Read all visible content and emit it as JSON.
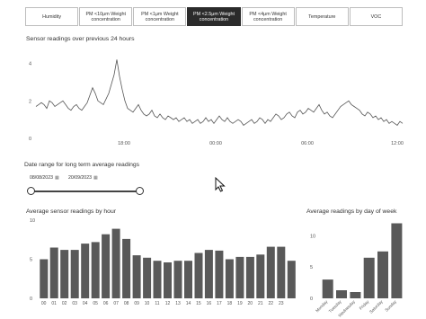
{
  "tabs": [
    {
      "label": "Humidity",
      "active": false
    },
    {
      "label": "PM <10μm Weight\nconcentration",
      "active": false
    },
    {
      "label": "PM <1μm Weight\nconcentration",
      "active": false
    },
    {
      "label": "PM <2.5μm Weight\nconcentration",
      "active": true
    },
    {
      "label": "PM <4μm Weight\nconcentration",
      "active": false
    },
    {
      "label": "Temperature",
      "active": false
    },
    {
      "label": "VOC",
      "active": false
    }
  ],
  "colors": {
    "active_tab": "#2b2b2b",
    "bars": "#595959",
    "line": "#555555"
  },
  "line_section": {
    "title": "Sensor readings over previous 24 hours"
  },
  "date_section": {
    "title": "Date range for long term average readings",
    "start_date": "08/08/2023",
    "end_date": "20/09/2023",
    "calendar_icon": "calendar-icon",
    "range_fraction": [
      0,
      1
    ]
  },
  "hour_section": {
    "title": "Average sensor readings by hour"
  },
  "week_section": {
    "title": "Average readings by day of week"
  },
  "cursor_icon": "arrow-cursor-icon",
  "chart_data": [
    {
      "type": "line",
      "title": "Sensor readings over previous 24 hours",
      "x_ticks": [
        "18:00",
        "00:00",
        "06:00",
        "12:00"
      ],
      "y_ticks": [
        0,
        2,
        4
      ],
      "ylim": [
        0,
        4.6
      ],
      "series": [
        {
          "values": [
            1.7,
            1.8,
            1.9,
            1.8,
            1.6,
            2.0,
            1.9,
            1.7,
            1.8,
            1.9,
            2.0,
            1.8,
            1.6,
            1.5,
            1.7,
            1.8,
            1.6,
            1.5,
            1.7,
            1.9,
            2.3,
            2.7,
            2.4,
            2.0,
            1.9,
            1.8,
            2.1,
            2.4,
            2.9,
            3.4,
            4.2,
            3.3,
            2.6,
            2.0,
            1.6,
            1.5,
            1.4,
            1.6,
            1.8,
            1.5,
            1.3,
            1.2,
            1.3,
            1.5,
            1.2,
            1.1,
            1.3,
            1.1,
            1.0,
            1.2,
            1.1,
            1.0,
            1.1,
            0.9,
            1.0,
            1.1,
            0.9,
            1.0,
            0.8,
            0.9,
            1.0,
            0.8,
            0.9,
            1.1,
            0.9,
            1.0,
            0.8,
            1.0,
            1.2,
            1.0,
            0.9,
            1.1,
            0.9,
            0.8,
            0.9,
            1.0,
            0.9,
            0.7,
            0.8,
            0.9,
            1.0,
            0.8,
            0.9,
            1.1,
            1.0,
            0.8,
            1.0,
            0.9,
            1.1,
            1.3,
            1.2,
            1.0,
            1.1,
            1.3,
            1.4,
            1.2,
            1.1,
            1.4,
            1.5,
            1.3,
            1.4,
            1.6,
            1.5,
            1.4,
            1.6,
            1.8,
            1.5,
            1.3,
            1.4,
            1.2,
            1.1,
            1.3,
            1.5,
            1.7,
            1.8,
            1.9,
            2.0,
            1.8,
            1.7,
            1.6,
            1.5,
            1.3,
            1.2,
            1.4,
            1.3,
            1.1,
            1.2,
            1.0,
            1.1,
            0.9,
            1.0,
            0.8,
            0.9,
            0.8,
            0.7,
            0.9,
            0.8
          ]
        }
      ]
    },
    {
      "type": "bar",
      "title": "Average sensor readings by hour",
      "categories": [
        "00",
        "01",
        "02",
        "03",
        "04",
        "05",
        "06",
        "07",
        "08",
        "09",
        "10",
        "11",
        "12",
        "13",
        "14",
        "15",
        "16",
        "17",
        "18",
        "19",
        "20",
        "21",
        "22",
        "23"
      ],
      "values": [
        5.0,
        6.5,
        6.2,
        6.2,
        7.0,
        7.2,
        8.2,
        8.9,
        7.6,
        5.5,
        5.2,
        4.8,
        4.6,
        4.8,
        4.8,
        5.8,
        6.2,
        6.1,
        5.0,
        5.3,
        5.3,
        5.6,
        6.6,
        6.6,
        4.8
      ],
      "y_ticks": [
        0,
        5,
        10
      ],
      "ylim": [
        0,
        10
      ]
    },
    {
      "type": "bar",
      "title": "Average readings by day of week",
      "categories": [
        "Monday",
        "Tuesday",
        "Wednesday",
        "Friday",
        "Saturday",
        "Sunday"
      ],
      "values": [
        3.0,
        1.3,
        1.0,
        6.5,
        7.5,
        12.0
      ],
      "y_ticks": [
        0,
        5,
        10
      ],
      "ylim": [
        0,
        12.5
      ]
    }
  ]
}
